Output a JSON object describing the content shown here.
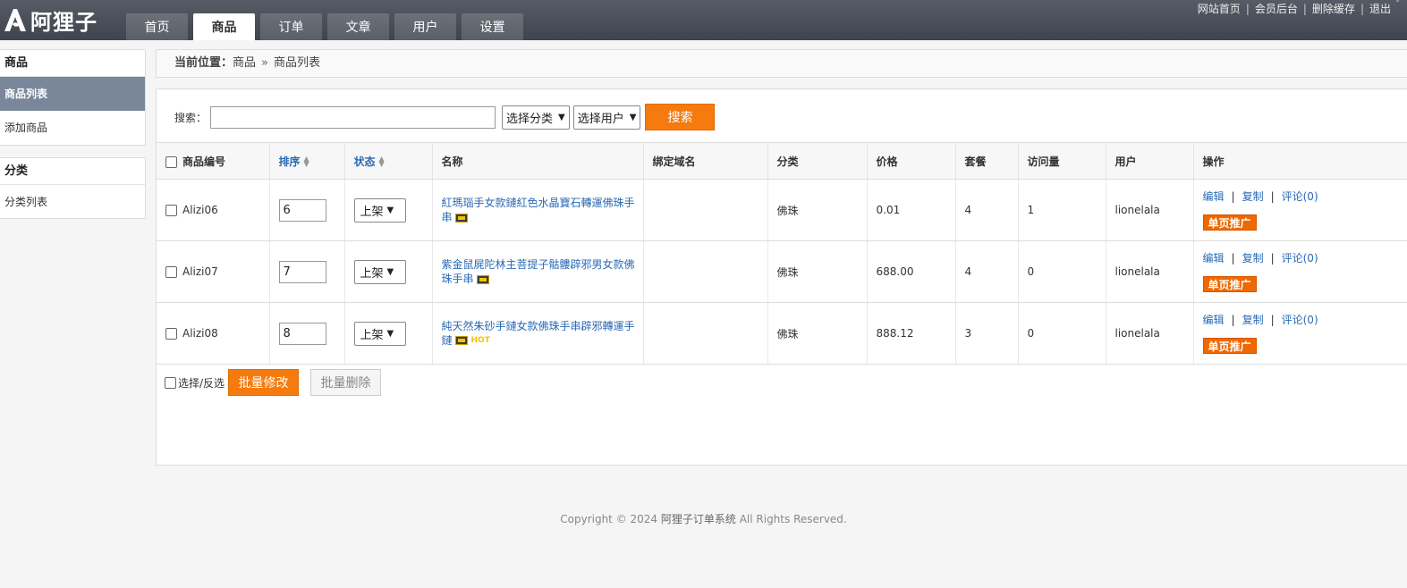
{
  "brand": {
    "name": "阿狸子"
  },
  "nav": {
    "tabs": [
      {
        "label": "首页",
        "active": false
      },
      {
        "label": "商品",
        "active": true
      },
      {
        "label": "订单",
        "active": false
      },
      {
        "label": "文章",
        "active": false
      },
      {
        "label": "用户",
        "active": false
      },
      {
        "label": "设置",
        "active": false
      }
    ]
  },
  "top_links": [
    "网站首页",
    "会员后台",
    "删除缓存",
    "退出"
  ],
  "sidebar": {
    "groups": [
      {
        "title": "商品",
        "items": [
          {
            "label": "商品列表",
            "active": true
          },
          {
            "label": "添加商品",
            "active": false
          }
        ]
      },
      {
        "title": "分类",
        "items": [
          {
            "label": "分类列表",
            "active": false
          }
        ]
      }
    ]
  },
  "breadcrumb": {
    "prefix": "当前位置：",
    "path": [
      "商品",
      "商品列表"
    ]
  },
  "search": {
    "label": "搜索：",
    "value": "",
    "category_select": "选择分类",
    "user_select": "选择用户",
    "button": "搜索"
  },
  "table": {
    "headers": [
      "商品编号",
      "排序",
      "状态",
      "名称",
      "绑定域名",
      "分类",
      "价格",
      "套餐",
      "访问量",
      "用户",
      "操作"
    ],
    "rows": [
      {
        "id": "Alizi06",
        "sort": "6",
        "status": "上架",
        "name": "紅瑪瑙手女款鏈紅色水晶寶石轉運佛珠手串",
        "hot": "",
        "domain": "",
        "category": "佛珠",
        "price": "0.01",
        "packages": "4",
        "visits": "1",
        "user": "lionelala"
      },
      {
        "id": "Alizi07",
        "sort": "7",
        "status": "上架",
        "name": "紫金鼠屍陀林主菩提子骷髏辟邪男女款佛珠手串",
        "hot": "",
        "domain": "",
        "category": "佛珠",
        "price": "688.00",
        "packages": "4",
        "visits": "0",
        "user": "lionelala"
      },
      {
        "id": "Alizi08",
        "sort": "8",
        "status": "上架",
        "name": "純天然朱砂手鏈女款佛珠手串辟邪轉運手鏈",
        "hot": "HOT",
        "domain": "",
        "category": "佛珠",
        "price": "888.12",
        "packages": "3",
        "visits": "0",
        "user": "lionelala"
      }
    ],
    "ops": {
      "edit": "编辑",
      "copy": "复制",
      "comments": "评论(0)",
      "promote": "单页推广"
    }
  },
  "batch": {
    "select_label": "选择/反选",
    "modify": "批量修改",
    "delete": "批量删除"
  },
  "footer": {
    "copyright": "Copyright © 2024 ",
    "system": "阿狸子订单系统",
    "rights": "  All Rights Reserved."
  },
  "colors": {
    "accent": "#f57b0e",
    "link": "#2a6ab5",
    "header": "#4a4f59",
    "sidebar_active": "#7a879a"
  }
}
